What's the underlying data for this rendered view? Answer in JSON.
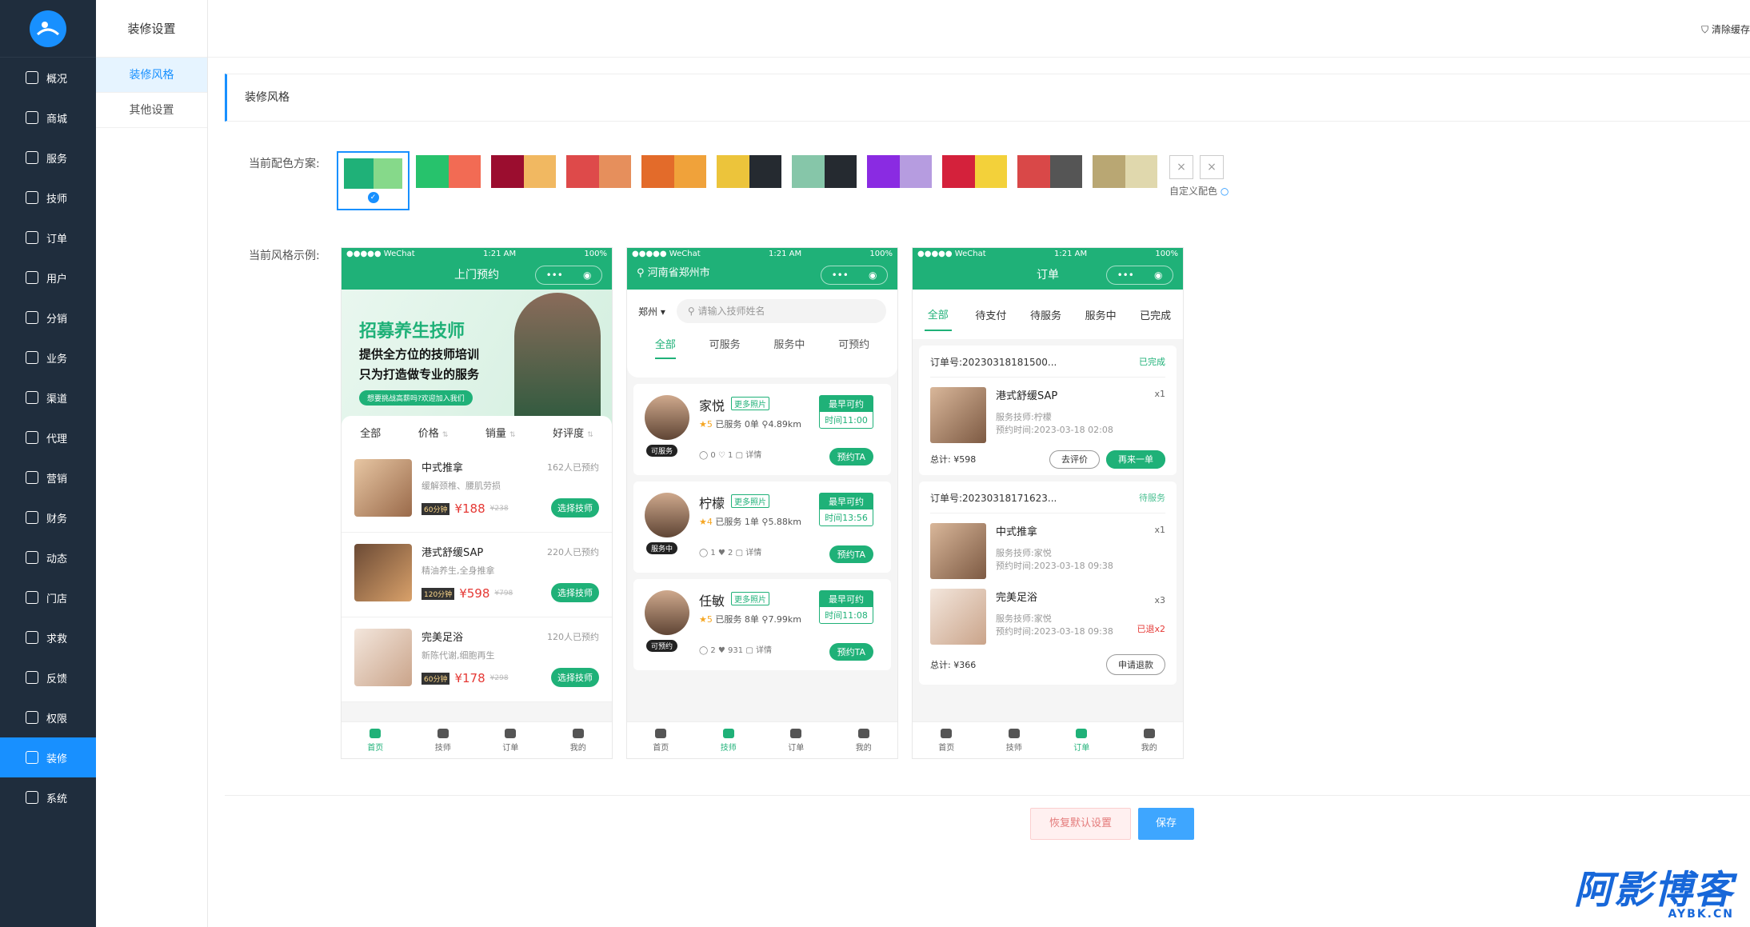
{
  "nav": [
    "概况",
    "商城",
    "服务",
    "技师",
    "订单",
    "用户",
    "分销",
    "业务",
    "渠道",
    "代理",
    "营销",
    "财务",
    "动态",
    "门店",
    "求救",
    "反馈",
    "权限",
    "装修",
    "系统"
  ],
  "subnav": {
    "title": "装修设置",
    "items": [
      "装修风格",
      "其他设置"
    ]
  },
  "topbar": {
    "clear_cache": "清除缓存"
  },
  "section": {
    "title": "装修风格"
  },
  "labels": {
    "scheme": "当前配色方案:",
    "example": "当前风格示例:",
    "custom": "自定义配色"
  },
  "swatches": [
    [
      "#1fb178",
      "#86d98a"
    ],
    [
      "#27c26c",
      "#f26b54"
    ],
    [
      "#9b0d2f",
      "#f1b861"
    ],
    [
      "#de4a4a",
      "#e68f5c"
    ],
    [
      "#e36b2a",
      "#f0a23a"
    ],
    [
      "#ecc43b",
      "#252a30"
    ],
    [
      "#86c6a9",
      "#252a30"
    ],
    [
      "#8a2be2",
      "#b69ce0"
    ],
    [
      "#d4213b",
      "#f3d13a"
    ],
    [
      "#d94848",
      "#555555"
    ],
    [
      "#b9a773",
      "#e0d8ad"
    ]
  ],
  "phone1": {
    "status_left": "●●●●● WeChat",
    "time": "1:21 AM",
    "battery": "100%",
    "title": "上门预约",
    "banner": {
      "line1": "招募养生技师",
      "line2": "提供全方位的技师培训",
      "line3": "只为打造做专业的服务",
      "line4": "想要挑战高薪吗?欢迎加入我们"
    },
    "sort": [
      "全部",
      "价格",
      "销量",
      "好评度"
    ],
    "products": [
      {
        "name": "中式推拿",
        "desc": "缓解颈椎、腰肌劳损",
        "tag": "60分钟",
        "price": "¥188",
        "oprice": "¥238",
        "booked": "162人已预约",
        "btn": "选择技师"
      },
      {
        "name": "港式舒缓SAP",
        "desc": "精油养生,全身推拿",
        "tag": "120分钟",
        "price": "¥598",
        "oprice": "¥798",
        "booked": "220人已预约",
        "btn": "选择技师"
      },
      {
        "name": "完美足浴",
        "desc": "新陈代谢,细胞再生",
        "tag": "60分钟",
        "price": "¥178",
        "oprice": "¥298",
        "booked": "120人已预约",
        "btn": "选择技师"
      }
    ]
  },
  "tabs_bottom": [
    "首页",
    "技师",
    "订单",
    "我的"
  ],
  "phone2": {
    "location": "河南省郑州市",
    "city": "郑州",
    "search": "请输入技师姓名",
    "tabs": [
      "全部",
      "可服务",
      "服务中",
      "可预约"
    ],
    "techs": [
      {
        "name": "家悦",
        "more": "更多照片",
        "stars": "★5",
        "served": "已服务 0单",
        "dist": "4.89km",
        "early": "最早可约",
        "time": "时间11:00",
        "status": "可服务",
        "social": "◯ 0 ♡ 1 ▢ 详情",
        "btn": "预约TA"
      },
      {
        "name": "柠檬",
        "more": "更多照片",
        "stars": "★4",
        "served": "已服务 1单",
        "dist": "5.88km",
        "early": "最早可约",
        "time": "时间13:56",
        "status": "服务中",
        "social": "◯ 1 ♥ 2 ▢ 详情",
        "btn": "预约TA"
      },
      {
        "name": "任敏",
        "more": "更多照片",
        "stars": "★5",
        "served": "已服务 8单",
        "dist": "7.99km",
        "early": "最早可约",
        "time": "时间11:08",
        "status": "可预约",
        "social": "◯ 2 ♥ 931 ▢ 详情",
        "btn": "预约TA"
      }
    ]
  },
  "phone3": {
    "title": "订单",
    "tabs": [
      "全部",
      "待支付",
      "待服务",
      "服务中",
      "已完成"
    ],
    "order1": {
      "no": "订单号:20230318181500...",
      "status": "已完成",
      "name": "港式舒缓SAP",
      "qty": "x1",
      "tech": "服务技师:柠檬",
      "time": "预约时间:2023-03-18 02:08",
      "total": "总计: ¥598",
      "btn1": "去评价",
      "btn2": "再来一单"
    },
    "order2": {
      "no": "订单号:20230318171623...",
      "status": "待服务",
      "items": [
        {
          "name": "中式推拿",
          "qty": "x1",
          "tech": "服务技师:家悦",
          "time": "预约时间:2023-03-18 09:38",
          "refund": ""
        },
        {
          "name": "完美足浴",
          "qty": "x3",
          "tech": "服务技师:家悦",
          "time": "预约时间:2023-03-18 09:38",
          "refund": "已退x2"
        }
      ],
      "total": "总计: ¥366",
      "btn": "申请退款"
    }
  },
  "actions": {
    "reset": "恢复默认设置",
    "save": "保存"
  },
  "watermark": {
    "main": "阿影博客",
    "sub": "AYBK.CN"
  }
}
